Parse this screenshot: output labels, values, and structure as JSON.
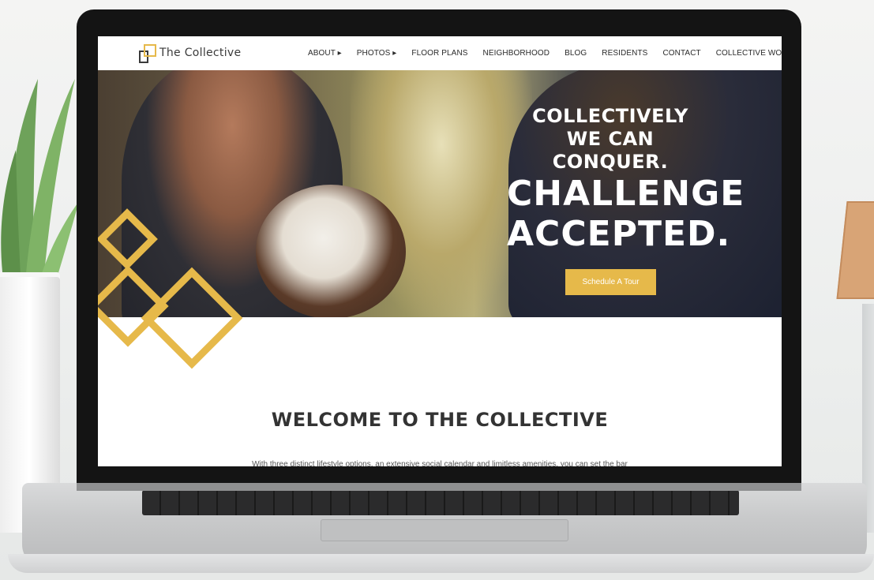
{
  "site": {
    "logo_text": "The Collective",
    "nav": [
      "ABOUT ▸",
      "PHOTOS ▸",
      "FLOOR PLANS",
      "NEIGHBORHOOD",
      "BLOG",
      "RESIDENTS",
      "CONTACT",
      "COLLECTIVE WORK"
    ]
  },
  "hero": {
    "line1": "COLLECTIVELY",
    "line2": "WE CAN CONQUER.",
    "line3": "CHALLENGE",
    "line4": "ACCEPTED.",
    "cta": "Schedule A Tour"
  },
  "welcome": {
    "heading": "WELCOME TO THE COLLECTIVE",
    "intro": "With three distinct lifestyle options, an extensive social calendar and limitless amenities, you can set the bar"
  },
  "colors": {
    "accent": "#e6b94a",
    "text_dark": "#333333",
    "bezel": "#141414"
  },
  "icons": [
    "logo-mark-icon",
    "diamond-pattern-icon"
  ]
}
